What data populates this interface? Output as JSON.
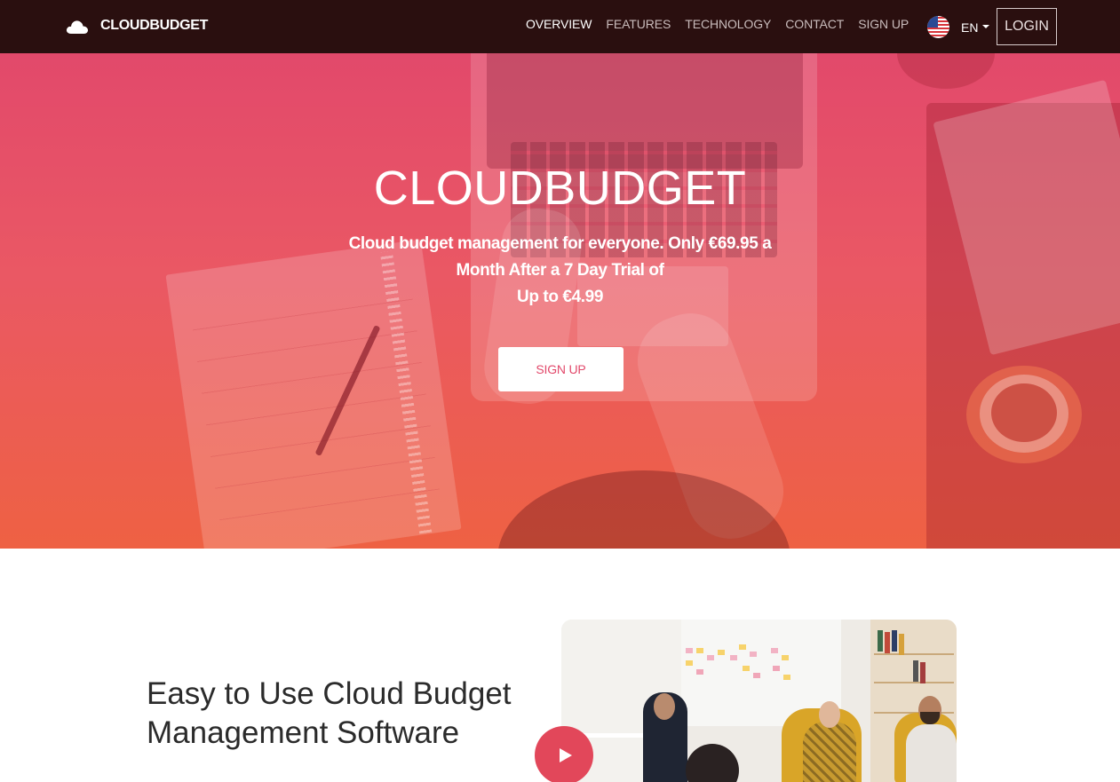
{
  "navbar": {
    "brand": "CLOUDBUDGET",
    "links": [
      {
        "label": "OVERVIEW",
        "active": true
      },
      {
        "label": "FEATURES",
        "active": false
      },
      {
        "label": "TECHNOLOGY",
        "active": false
      },
      {
        "label": "CONTACT",
        "active": false
      },
      {
        "label": "SIGN UP",
        "active": false
      }
    ],
    "language": "EN",
    "login_label": "LOGIN"
  },
  "hero": {
    "title": "CLOUDBUDGET",
    "subtitle_lines": [
      "Cloud budget management for everyone. Only €69.95 a",
      "Month After a 7 Day Trial of",
      "Up to €4.99"
    ],
    "signup_label": "SIGN UP"
  },
  "intro": {
    "title_lines": [
      "Easy to Use Cloud Budget",
      "Management Software"
    ]
  },
  "icons": {
    "brand": "cloud-icon",
    "flag": "us-flag-icon",
    "language_caret": "caret-down-icon",
    "video": "play-icon"
  },
  "colors": {
    "navbar_bg": "#2a0f0f",
    "hero_top": "#e2496b",
    "hero_bottom": "#ee6143",
    "accent": "#e2496b",
    "play_button": "#e2475a",
    "heading_text": "#2b2b2b"
  }
}
